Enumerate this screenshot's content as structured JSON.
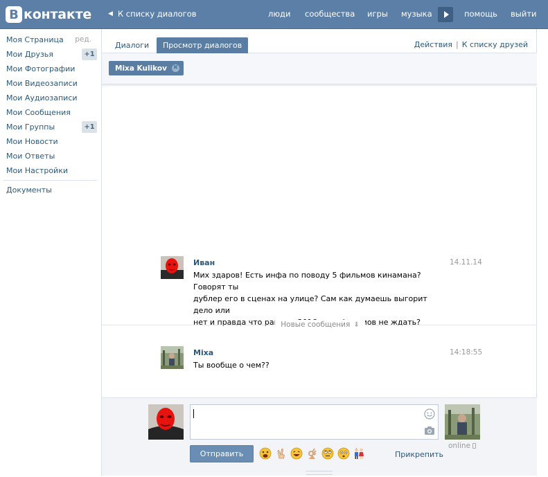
{
  "header": {
    "logo_letter": "B",
    "logo_text": "контакте",
    "back_label": "К списку диалогов",
    "nav": [
      "люди",
      "сообщества",
      "игры",
      "музыка",
      "помощь",
      "выйти"
    ]
  },
  "sidebar": {
    "items": [
      {
        "label": "Моя Страница",
        "extra": "ред."
      },
      {
        "label": "Мои Друзья",
        "badge": "+1"
      },
      {
        "label": "Мои Фотографии"
      },
      {
        "label": "Мои Видеозаписи"
      },
      {
        "label": "Мои Аудиозаписи"
      },
      {
        "label": "Мои Сообщения"
      },
      {
        "label": "Мои Группы",
        "badge": "+1"
      },
      {
        "label": "Мои Новости"
      },
      {
        "label": "Мои Ответы"
      },
      {
        "label": "Мои Настройки"
      }
    ],
    "documents": "Документы"
  },
  "tabs": {
    "dialogs": "Диалоги",
    "view_dialogs": "Просмотр диалогов"
  },
  "top_actions": {
    "actions": "Действия",
    "separator": "|",
    "friends_list": "К списку друзей"
  },
  "peer": {
    "name": "Mixa Kulikov",
    "remove_symbol": "✖"
  },
  "messages": [
    {
      "author": "Иван",
      "time": "14.11.14",
      "lines": [
        "Мих здаров! Есть инфа по поводу 5 фильмов кинамана? Говорят ты",
        "дублер его в сценах на улице? Сам как думаешь выгорит дело или",
        "нет и правда что раньше 2016 года фильмов не ждать?"
      ]
    },
    {
      "author": "Mixa",
      "time": "14:18:55",
      "lines": [
        "Ты вообще о чем??"
      ]
    }
  ],
  "new_messages_label": "Новые сообщения",
  "composer": {
    "send_label": "Отправить",
    "attach_label": "Прикрепить",
    "online_label": "online",
    "value": "",
    "emoji_count": 7
  },
  "colors": {
    "header_bg": "#5b7fa6",
    "link": "#2b587a",
    "accent": "#597da3"
  },
  "icons": [
    "smile-icon",
    "camera-icon",
    "mobile-icon",
    "chevron-left-icon",
    "play-icon",
    "arrow-down-icon",
    "close-icon"
  ]
}
